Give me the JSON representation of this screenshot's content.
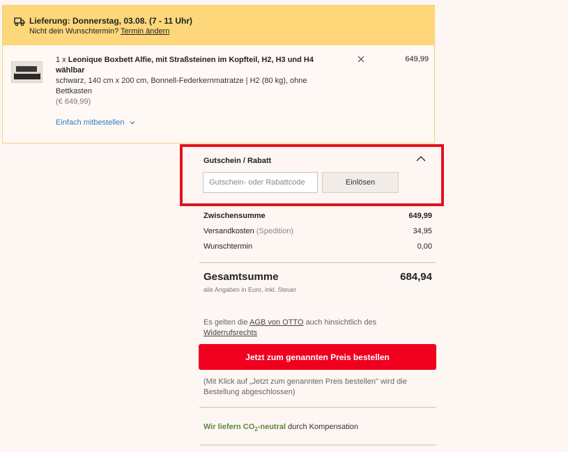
{
  "delivery": {
    "title": "Lieferung: Donnerstag, 03.08. (7 - 11 Uhr)",
    "subtitle_prefix": "Nicht dein Wunschtermin?",
    "change_link": "Termin ändern"
  },
  "product": {
    "quantity": "1 x",
    "name": "Leonique Boxbett Alfie, mit Straßsteinen im Kopfteil, H2, H3 und H4 wählbar",
    "description": "schwarz, 140 cm x 200 cm, Bonnell-Federkernmatratze | H2 (80 kg), ohne Bettkasten",
    "unit_price_note": "(€ 649,99)",
    "price": "649,99",
    "addon_link": "Einfach mitbestellen"
  },
  "coupon": {
    "title": "Gutschein / Rabatt",
    "placeholder": "Gutschein- oder Rabattcode",
    "button": "Einlösen"
  },
  "summary": {
    "rows": [
      {
        "label": "Zwischensumme",
        "extra": "",
        "value": "649,99"
      },
      {
        "label": "Versandkosten",
        "extra": "(Spedition)",
        "value": "34,95"
      },
      {
        "label": "Wunschtermin",
        "extra": "",
        "value": "0,00"
      }
    ],
    "total_label": "Gesamtsumme",
    "total_value": "684,94",
    "total_note": "alle Angaben in Euro, inkl. Steuer"
  },
  "legal": {
    "prefix": "Es gelten die",
    "agb_link": "AGB von OTTO",
    "middle": "auch hinsichtlich des",
    "withdrawal_link": "Widerrufsrechts"
  },
  "order": {
    "button": "Jetzt zum genannten Preis bestellen",
    "note": "(Mit Klick auf „Jetzt zum genannten Preis bestellen\" wird die Bestellung abgeschlossen)"
  },
  "co2": {
    "green_prefix": "Wir liefern CO",
    "green_sub": "2",
    "green_suffix": "-neutral",
    "rest": "durch Kompensation"
  },
  "colors": {
    "accent_red": "#f0001f",
    "highlight_border": "#e3131b",
    "delivery_yellow": "#fdd77a",
    "link_blue": "#2e7cc4",
    "co2_green": "#5a8a3a"
  },
  "icons": [
    "truck-icon",
    "close-icon",
    "chevron-down-icon",
    "chevron-up-icon"
  ]
}
